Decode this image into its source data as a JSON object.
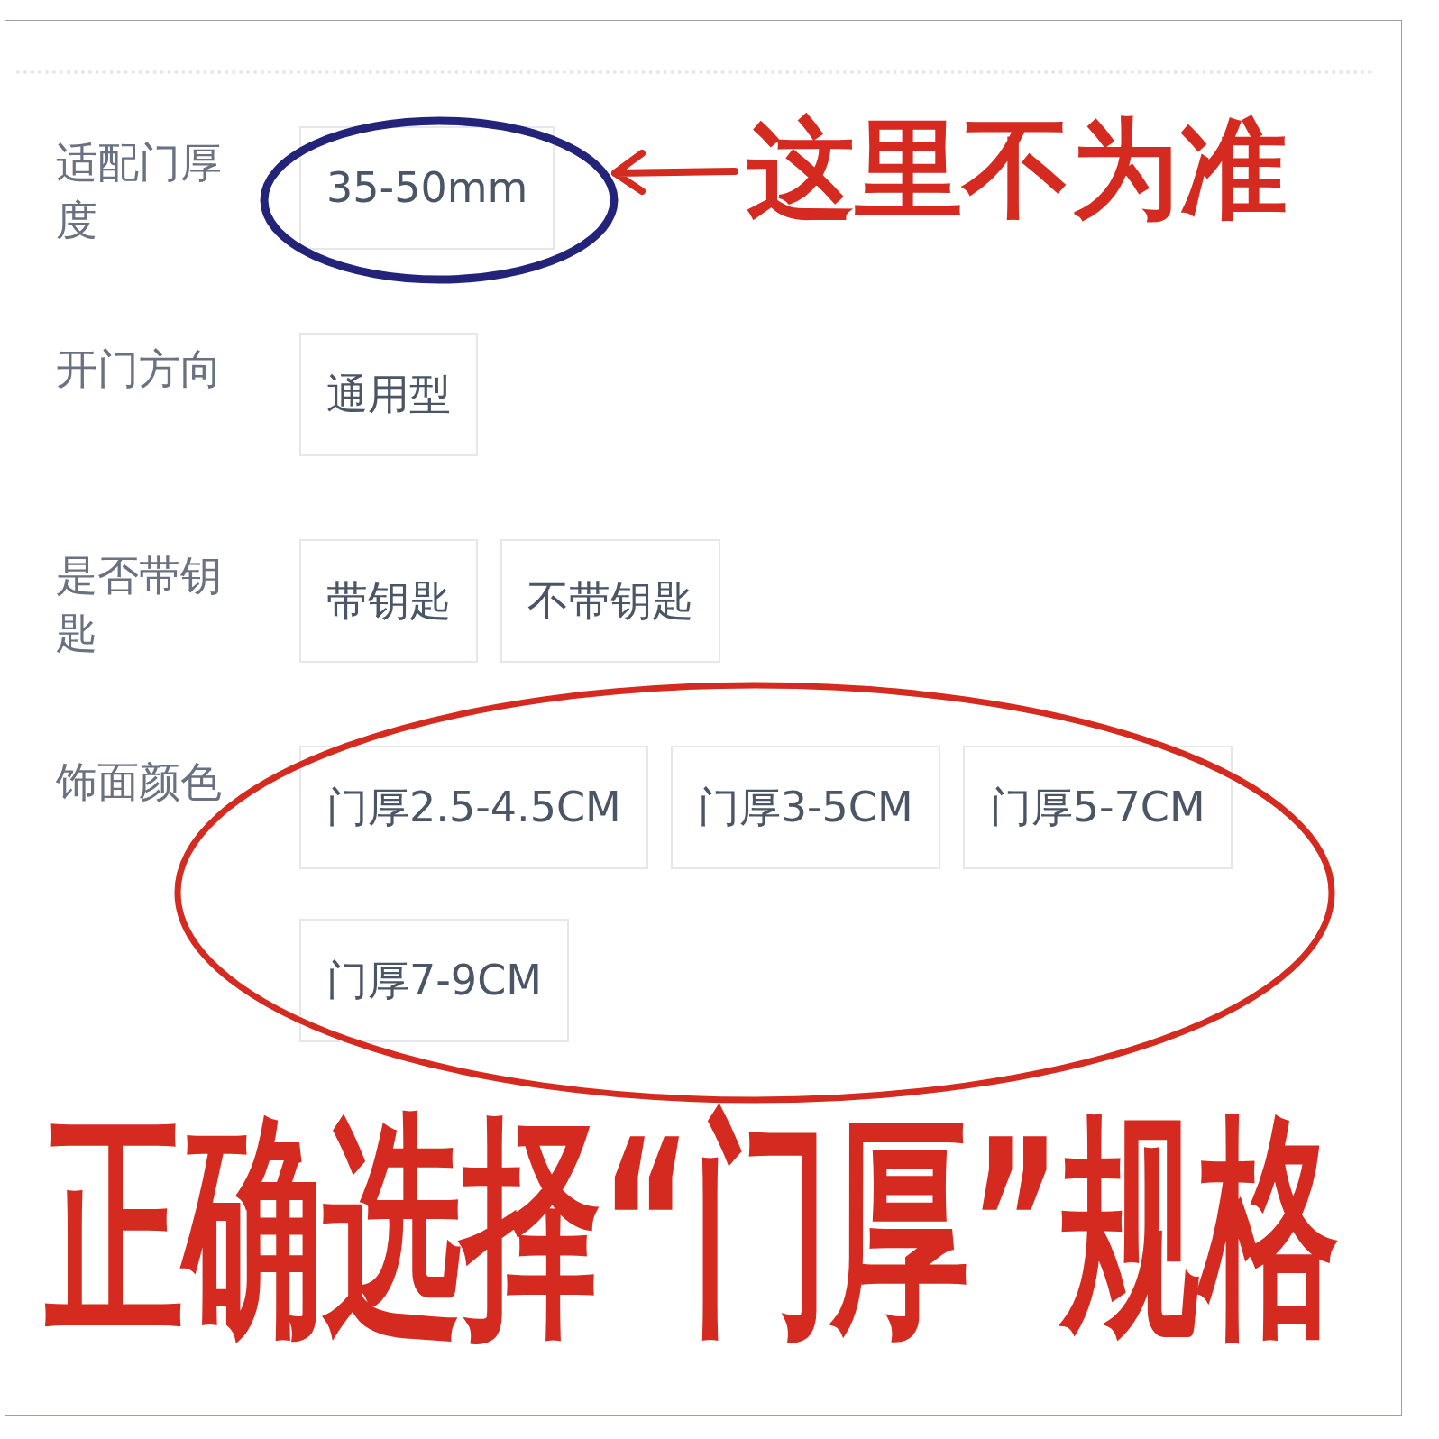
{
  "attributes": [
    {
      "label": "适配门厚度",
      "options": [
        {
          "text": "35-50mm",
          "selected": false
        }
      ]
    },
    {
      "label": "开门方向",
      "options": [
        {
          "text": "通用型",
          "selected": false
        }
      ]
    },
    {
      "label": "是否带钥匙",
      "options": [
        {
          "text": "带钥匙",
          "selected": false
        },
        {
          "text": "不带钥匙",
          "selected": false
        }
      ]
    },
    {
      "label": "饰面颜色",
      "options": [
        {
          "text": "门厚2.5-4.5CM",
          "selected": false
        },
        {
          "text": "门厚3-5CM",
          "selected": false
        },
        {
          "text": "门厚5-7CM",
          "selected": false
        },
        {
          "text": "门厚7-9CM",
          "selected": false
        }
      ]
    }
  ],
  "annotations": {
    "note": "这里不为准",
    "headline": "正确选择“门厚”规格"
  }
}
